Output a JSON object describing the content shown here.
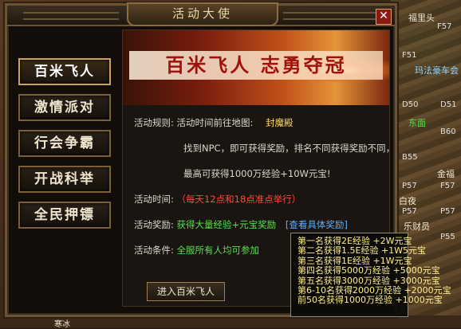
{
  "window": {
    "title": "活动大使",
    "close_symbol": "✕"
  },
  "nav": [
    {
      "label": "百米飞人",
      "active": true
    },
    {
      "label": "激情派对",
      "active": false
    },
    {
      "label": "行会争霸",
      "active": false
    },
    {
      "label": "开战科举",
      "active": false
    },
    {
      "label": "全民押镖",
      "active": false
    }
  ],
  "banner": {
    "text": "百米飞人 志勇夺冠"
  },
  "rules": {
    "rule_label": "活动规则:",
    "rule_line1": "活动时间前往地图:",
    "map_name": "封魔殿",
    "rule_line2": "找到NPC，即可获得奖励，排名不同获得奖励不同，",
    "rule_line3": "最高可获得1000万经验+10W元宝!",
    "time_label": "活动时间:",
    "time_value": "（每天12点和18点准点举行）",
    "reward_label": "活动奖励:",
    "reward_value": "获得大量经验+元宝奖励",
    "reward_link": "[查看具体奖励]",
    "cond_label": "活动条件:",
    "cond_value": "全服所有人均可参加"
  },
  "enter_button": "进入百米飞人",
  "tooltip": [
    "第一名获得2E经验   +2W元宝",
    "第二名获得1.5E经验  +1W5元宝",
    "第三名获得1E经验    +1W元宝",
    "第四名获得5000万经验  +5000元宝",
    "第五名获得3000万经验  +3000元宝",
    "第6-10名获得2000万经验  +2000元宝",
    "前50名获得1000万经验  +1000元宝"
  ],
  "map_labels": [
    "福里头",
    "F57",
    "F51",
    "玛法豪车会",
    "D50",
    "D51",
    "东面",
    "B60",
    "B55",
    "金福",
    "P57",
    "F57",
    "白夜",
    "P57",
    "P57",
    "乐财员",
    "P55",
    "寒冰"
  ],
  "colors": {
    "accent_gold": "#ffd860",
    "red": "#ff4a3a",
    "green": "#5adf4e",
    "blue": "#5ab0ff",
    "frame": "#6b5434"
  }
}
